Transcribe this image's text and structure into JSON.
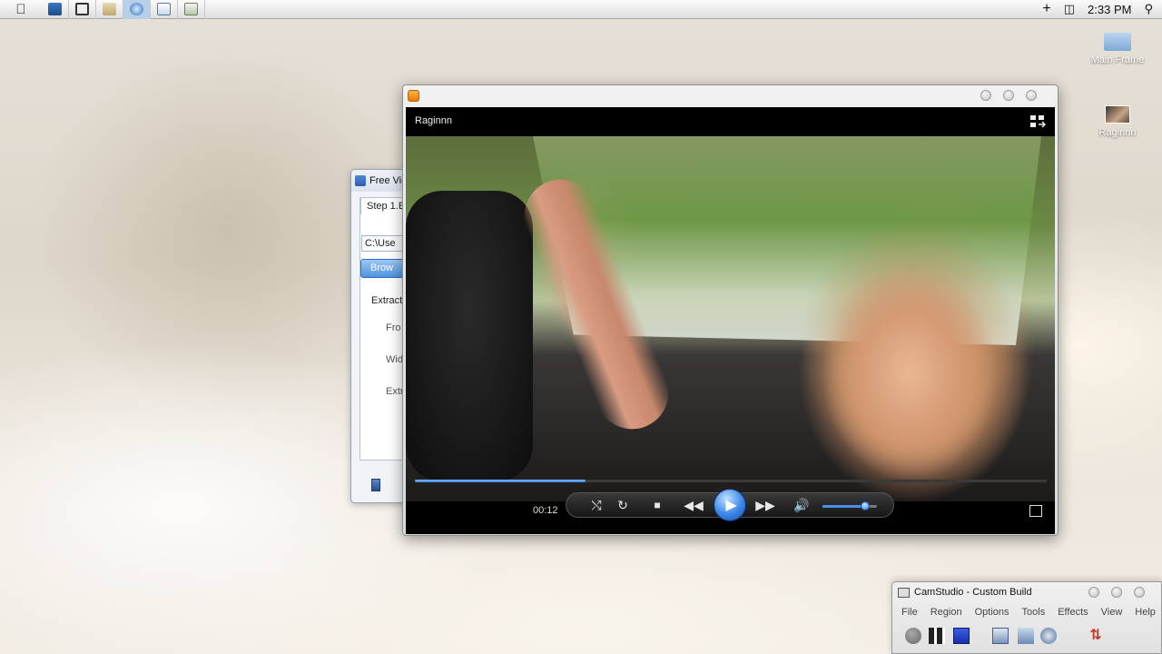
{
  "menubar": {
    "apple_icon": "apple-icon",
    "app_icons": [
      "photoshop-icon",
      "window-icon",
      "notepad-icon",
      "browser-icon",
      "calendar-icon",
      "document-icon"
    ],
    "clock": "2:33 PM",
    "status_icons": [
      "add-icon",
      "device-icon",
      "search-icon"
    ]
  },
  "desktop": {
    "icons": [
      {
        "label": "Main Frame",
        "icon": "folder-icon"
      },
      {
        "label": "Raginnn",
        "icon": "video-thumbnail-icon"
      }
    ]
  },
  "dialog": {
    "title": "Free Vid",
    "tab_label": "Step 1.E",
    "path_value": "C:\\Use",
    "browse_label": "Brow",
    "group_label": "Extract",
    "field_labels": [
      "Fro",
      "Widt",
      "Extr"
    ]
  },
  "player": {
    "video_title": "Raginnn",
    "time_elapsed": "00:12",
    "progress_fraction": 0.27,
    "volume_fraction": 0.78,
    "controls": [
      "shuffle-icon",
      "repeat-icon",
      "stop-icon",
      "rewind-icon",
      "play-icon",
      "fast-forward-icon",
      "volume-icon"
    ],
    "accent_color": "#3b86e8"
  },
  "camstudio": {
    "title": "CamStudio - Custom Build",
    "menu": [
      "File",
      "Region",
      "Options",
      "Tools",
      "Effects",
      "View",
      "Help"
    ]
  }
}
